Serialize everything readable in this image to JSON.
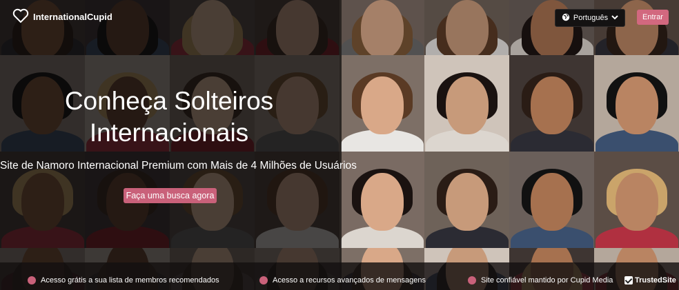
{
  "header": {
    "logo_text": "InternationalCupid",
    "language_label": "Português",
    "login_label": "Entrar"
  },
  "hero": {
    "title": "Conheça Solteiros Internacionais",
    "subtitle": "Site de Namoro Internacional Premium com Mais de 4 Milhões de Usuários",
    "cta_label": "Faça uma busca agora"
  },
  "features": [
    {
      "label": "Acesso grátis a sua lista de membros recomendados"
    },
    {
      "label": "Acesso a recursos avançados de mensagens"
    },
    {
      "label": "Site confiável mantido por Cupid Media"
    }
  ],
  "trust_badge": {
    "label": "TrustedSite"
  },
  "colors": {
    "accent": "#d2687f",
    "cta": "#c9617a",
    "overlay": "#0a0808"
  },
  "icons": {
    "logo": "heart-icon",
    "language": "globe-icon",
    "dropdown": "chevron-down-icon",
    "bullet": "dot-icon",
    "trusted": "checkmark-icon"
  }
}
